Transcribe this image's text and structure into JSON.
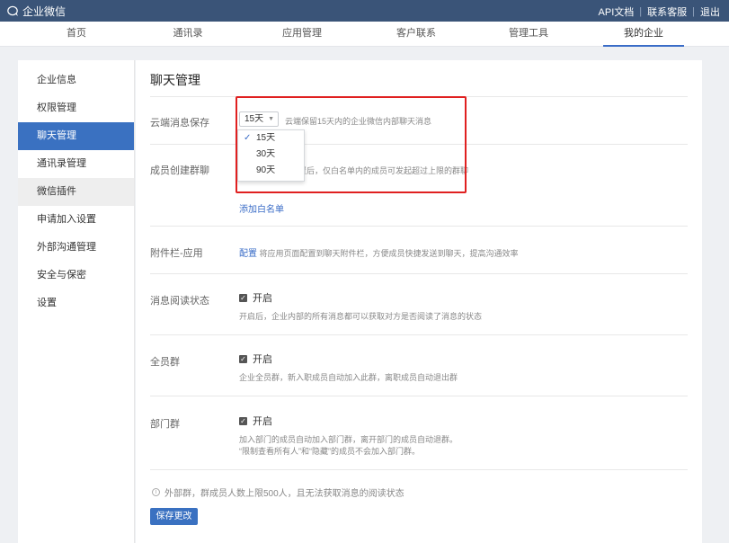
{
  "topbar": {
    "app_name": "企业微信",
    "links": [
      "API文档",
      "联系客服",
      "退出"
    ],
    "separator": "|"
  },
  "nav": {
    "items": [
      "首页",
      "通讯录",
      "应用管理",
      "客户联系",
      "管理工具",
      "我的企业"
    ],
    "active": "我的企业"
  },
  "sidebar": {
    "items": [
      "企业信息",
      "权限管理",
      "聊天管理",
      "通讯录管理",
      "微信插件",
      "申请加入设置",
      "外部沟通管理",
      "安全与保密",
      "设置"
    ],
    "active": "聊天管理"
  },
  "main": {
    "title": "聊天管理",
    "cloud": {
      "label": "云端消息保存",
      "selected": "15天",
      "desc": "云端保留15天内的企业微信内部聊天消息",
      "options": [
        "15天",
        "30天",
        "90天"
      ]
    },
    "group_create": {
      "label": "成员创建群聊",
      "desc": "设置后，仅白名单内的成员可发起超过上限的群聊",
      "add_link": "添加白名单"
    },
    "attach": {
      "label": "附件栏-应用",
      "link": "配置",
      "desc": "将应用页面配置到聊天附件栏，方便成员快捷发送到聊天，提高沟通效率"
    },
    "read_status": {
      "label": "消息阅读状态",
      "check_label": "开启",
      "desc": "开启后，企业内部的所有消息都可以获取对方是否阅读了消息的状态"
    },
    "all_group": {
      "label": "全员群",
      "check_label": "开启",
      "desc": "企业全员群，新入职成员自动加入此群，离职成员自动退出群"
    },
    "dept_group": {
      "label": "部门群",
      "check_label": "开启",
      "desc1": "加入部门的成员自动加入部门群，离开部门的成员自动退群。",
      "desc2": "“限制查看所有人”和“隐藏”的成员不会加入部门群。"
    },
    "footer_note": "外部群，群成员人数上限500人，且无法获取消息的阅读状态",
    "save_label": "保存更改"
  },
  "colors": {
    "topbar": "#3a5478",
    "accent": "#3a71c1",
    "highlight_box": "#e02020"
  }
}
